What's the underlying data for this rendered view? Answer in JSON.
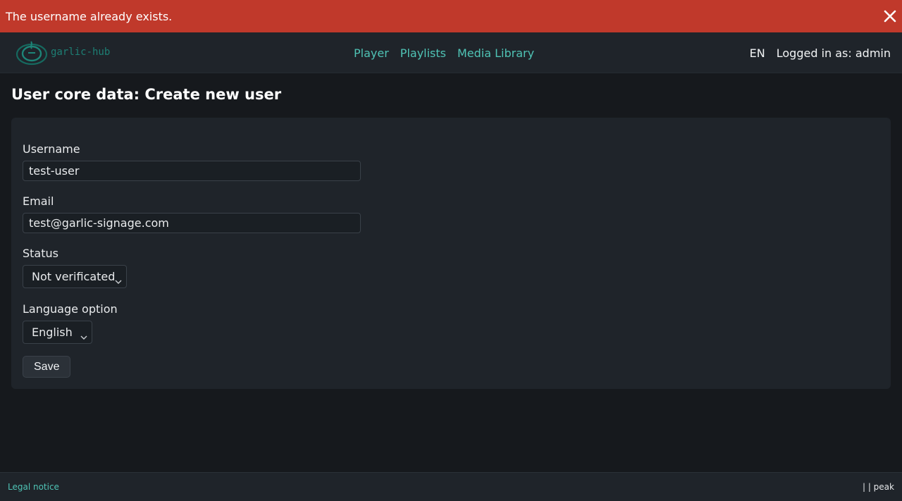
{
  "alert": {
    "message": "The username already exists.",
    "close_icon": "close-icon",
    "color": "#c0392b"
  },
  "header": {
    "logo_text": "garlic-hub",
    "nav": [
      {
        "label": "Player"
      },
      {
        "label": "Playlists"
      },
      {
        "label": "Media Library"
      }
    ],
    "language": "EN",
    "logged_in": "Logged in as: admin",
    "accent_color": "#4fc3b5"
  },
  "page": {
    "title": "User core data: Create new user"
  },
  "form": {
    "username_label": "Username",
    "username_value": "test-user",
    "email_label": "Email",
    "email_value": "test@garlic-signage.com",
    "status_label": "Status",
    "status_value": "Not verificated",
    "language_label": "Language option",
    "language_value": "English",
    "save_label": "Save"
  },
  "footer": {
    "legal_notice": "Legal notice",
    "right_text": "| | peak"
  }
}
